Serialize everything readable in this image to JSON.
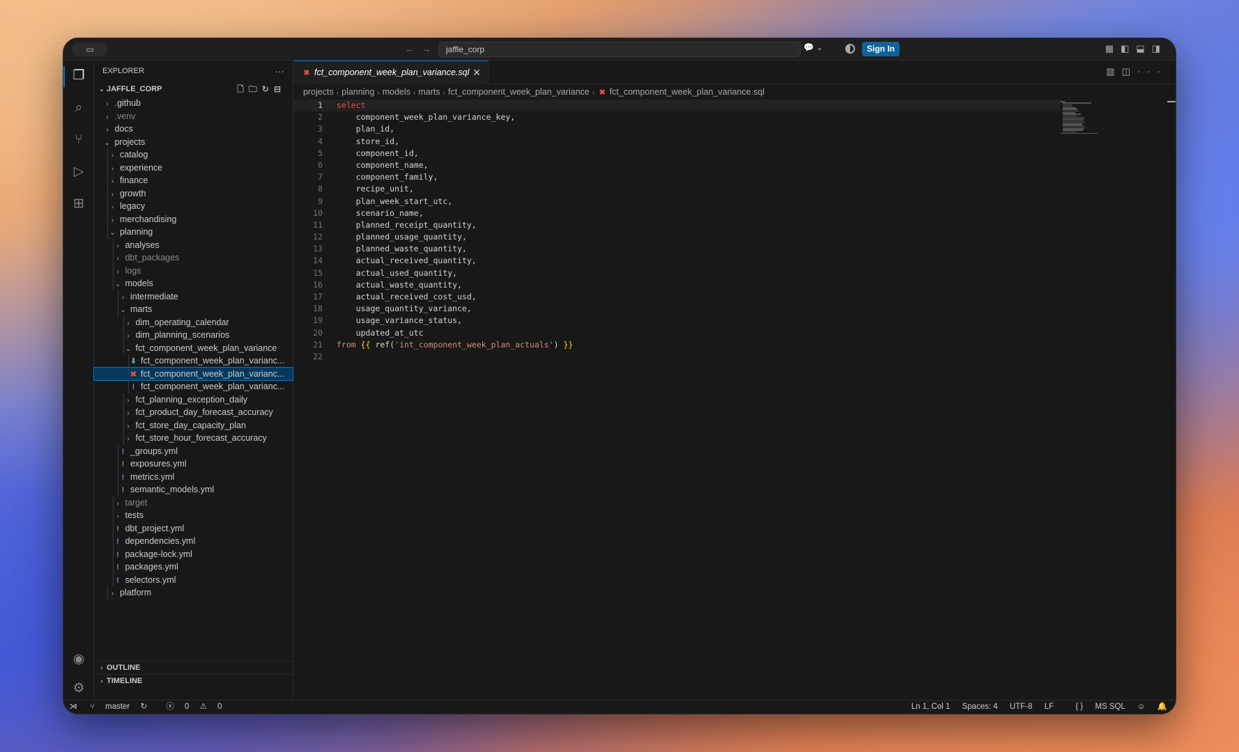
{
  "titlebar": {
    "command_center": "jaffle_corp",
    "sign_in": "Sign In"
  },
  "sidebar": {
    "title": "EXPLORER",
    "root": "JAFFLE_CORP",
    "tree": [
      {
        "label": ".github",
        "depth": 0,
        "type": "folder",
        "open": false
      },
      {
        "label": ".venv",
        "depth": 0,
        "type": "folder",
        "open": false,
        "dim": true
      },
      {
        "label": "docs",
        "depth": 0,
        "type": "folder",
        "open": false
      },
      {
        "label": "projects",
        "depth": 0,
        "type": "folder",
        "open": true
      },
      {
        "label": "catalog",
        "depth": 1,
        "type": "folder",
        "open": false
      },
      {
        "label": "experience",
        "depth": 1,
        "type": "folder",
        "open": false
      },
      {
        "label": "finance",
        "depth": 1,
        "type": "folder",
        "open": false
      },
      {
        "label": "growth",
        "depth": 1,
        "type": "folder",
        "open": false
      },
      {
        "label": "legacy",
        "depth": 1,
        "type": "folder",
        "open": false
      },
      {
        "label": "merchandising",
        "depth": 1,
        "type": "folder",
        "open": false
      },
      {
        "label": "planning",
        "depth": 1,
        "type": "folder",
        "open": true
      },
      {
        "label": "analyses",
        "depth": 2,
        "type": "folder",
        "open": false
      },
      {
        "label": "dbt_packages",
        "depth": 2,
        "type": "folder",
        "open": false,
        "dim": true
      },
      {
        "label": "logs",
        "depth": 2,
        "type": "folder",
        "open": false,
        "dim": true
      },
      {
        "label": "models",
        "depth": 2,
        "type": "folder",
        "open": true
      },
      {
        "label": "intermediate",
        "depth": 3,
        "type": "folder",
        "open": false
      },
      {
        "label": "marts",
        "depth": 3,
        "type": "folder",
        "open": true
      },
      {
        "label": "dim_operating_calendar",
        "depth": 4,
        "type": "folder",
        "open": false
      },
      {
        "label": "dim_planning_scenarios",
        "depth": 4,
        "type": "folder",
        "open": false
      },
      {
        "label": "fct_component_week_plan_variance",
        "depth": 4,
        "type": "folder",
        "open": true
      },
      {
        "label": "fct_component_week_plan_varianc...",
        "depth": 5,
        "type": "file",
        "icon": "dl"
      },
      {
        "label": "fct_component_week_plan_varianc...",
        "depth": 5,
        "type": "file",
        "icon": "x",
        "selected": true
      },
      {
        "label": "fct_component_week_plan_varianc...",
        "depth": 5,
        "type": "file",
        "icon": "excl"
      },
      {
        "label": "fct_planning_exception_daily",
        "depth": 4,
        "type": "folder",
        "open": false
      },
      {
        "label": "fct_product_day_forecast_accuracy",
        "depth": 4,
        "type": "folder",
        "open": false
      },
      {
        "label": "fct_store_day_capacity_plan",
        "depth": 4,
        "type": "folder",
        "open": false
      },
      {
        "label": "fct_store_hour_forecast_accuracy",
        "depth": 4,
        "type": "folder",
        "open": false
      },
      {
        "label": "_groups.yml",
        "depth": 3,
        "type": "file",
        "icon": "excl"
      },
      {
        "label": "exposures.yml",
        "depth": 3,
        "type": "file",
        "icon": "excl"
      },
      {
        "label": "metrics.yml",
        "depth": 3,
        "type": "file",
        "icon": "excl"
      },
      {
        "label": "semantic_models.yml",
        "depth": 3,
        "type": "file",
        "icon": "excl"
      },
      {
        "label": "target",
        "depth": 2,
        "type": "folder",
        "open": false,
        "dim": true
      },
      {
        "label": "tests",
        "depth": 2,
        "type": "folder",
        "open": false
      },
      {
        "label": "dbt_project.yml",
        "depth": 2,
        "type": "file",
        "icon": "excl"
      },
      {
        "label": "dependencies.yml",
        "depth": 2,
        "type": "file",
        "icon": "excl"
      },
      {
        "label": "package-lock.yml",
        "depth": 2,
        "type": "file",
        "icon": "excl"
      },
      {
        "label": "packages.yml",
        "depth": 2,
        "type": "file",
        "icon": "excl"
      },
      {
        "label": "selectors.yml",
        "depth": 2,
        "type": "file",
        "icon": "excl"
      },
      {
        "label": "platform",
        "depth": 1,
        "type": "folder",
        "open": false
      }
    ],
    "outline": "OUTLINE",
    "timeline": "TIMELINE"
  },
  "editor": {
    "tab_label": "fct_component_week_plan_variance.sql",
    "breadcrumb": [
      "projects",
      "planning",
      "models",
      "marts",
      "fct_component_week_plan_variance"
    ],
    "breadcrumb_file": "fct_component_week_plan_variance.sql",
    "lines": [
      {
        "n": "1",
        "parts": [
          [
            "kw",
            "select"
          ]
        ]
      },
      {
        "n": "2",
        "parts": [
          [
            "id",
            "    component_week_plan_variance_key,"
          ]
        ]
      },
      {
        "n": "3",
        "parts": [
          [
            "id",
            "    plan_id,"
          ]
        ]
      },
      {
        "n": "4",
        "parts": [
          [
            "id",
            "    store_id,"
          ]
        ]
      },
      {
        "n": "5",
        "parts": [
          [
            "id",
            "    component_id,"
          ]
        ]
      },
      {
        "n": "6",
        "parts": [
          [
            "id",
            "    component_name,"
          ]
        ]
      },
      {
        "n": "7",
        "parts": [
          [
            "id",
            "    component_family,"
          ]
        ]
      },
      {
        "n": "8",
        "parts": [
          [
            "id",
            "    recipe_unit,"
          ]
        ]
      },
      {
        "n": "9",
        "parts": [
          [
            "id",
            "    plan_week_start_utc,"
          ]
        ]
      },
      {
        "n": "10",
        "parts": [
          [
            "id",
            "    scenario_name,"
          ]
        ]
      },
      {
        "n": "11",
        "parts": [
          [
            "id",
            "    planned_receipt_quantity,"
          ]
        ]
      },
      {
        "n": "12",
        "parts": [
          [
            "id",
            "    planned_usage_quantity,"
          ]
        ]
      },
      {
        "n": "13",
        "parts": [
          [
            "id",
            "    planned_waste_quantity,"
          ]
        ]
      },
      {
        "n": "14",
        "parts": [
          [
            "id",
            "    actual_received_quantity,"
          ]
        ]
      },
      {
        "n": "15",
        "parts": [
          [
            "id",
            "    actual_used_quantity,"
          ]
        ]
      },
      {
        "n": "16",
        "parts": [
          [
            "id",
            "    actual_waste_quantity,"
          ]
        ]
      },
      {
        "n": "17",
        "parts": [
          [
            "id",
            "    actual_received_cost_usd,"
          ]
        ]
      },
      {
        "n": "18",
        "parts": [
          [
            "id",
            "    usage_quantity_variance,"
          ]
        ]
      },
      {
        "n": "19",
        "parts": [
          [
            "id",
            "    usage_variance_status,"
          ]
        ]
      },
      {
        "n": "20",
        "parts": [
          [
            "id",
            "    updated_at_utc"
          ]
        ]
      },
      {
        "n": "21",
        "parts": [
          [
            "kw2",
            "from"
          ],
          [
            "id",
            " "
          ],
          [
            "br",
            "{{"
          ],
          [
            "id",
            " "
          ],
          [
            "fn",
            "ref"
          ],
          [
            "id",
            "("
          ],
          [
            "str",
            "'int_component_week_plan_actuals'"
          ],
          [
            "id",
            ")"
          ],
          [
            "id",
            " "
          ],
          [
            "br",
            "}}"
          ]
        ]
      },
      {
        "n": "22",
        "parts": []
      }
    ]
  },
  "statusbar": {
    "branch": "master",
    "errors": "0",
    "warnings": "0",
    "position": "Ln 1, Col 1",
    "spaces": "Spaces: 4",
    "encoding": "UTF-8",
    "eol": "LF",
    "language": "MS SQL"
  },
  "colors": {
    "accent": "#0078d4",
    "signin": "#0e639c",
    "keyword": "#f14c4c"
  }
}
